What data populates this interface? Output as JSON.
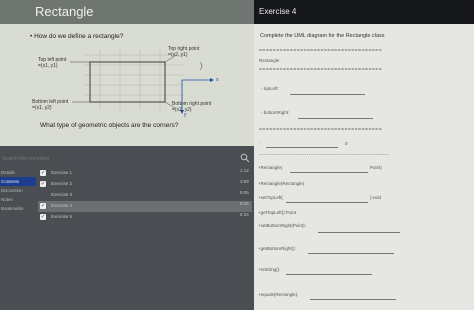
{
  "slide": {
    "title": "Rectangle",
    "bullet": "• How do we define a rectangle?",
    "labels": {
      "top_right": [
        "Top right point",
        "=(x2, y1)"
      ],
      "top_left": [
        "Top left point",
        "=(x1, y1)"
      ],
      "bottom_left": [
        "Bottom left point",
        "=(x1, y2)"
      ],
      "bottom_right": [
        "Bottom right point",
        "=(x2, y2)"
      ]
    },
    "axis_x": "x",
    "axis_y": "y",
    "question": "What type of geometric objects are the corners?"
  },
  "exercise": {
    "title": "Exercise 4",
    "instruction": "Complete the UML diagram for the Rectangle class",
    "class_name": "Rectangle",
    "fields": [
      "- topLeft:",
      "- bottomRight:"
    ],
    "field_zero": "0",
    "methods": [
      {
        "text": "+Rectangle(",
        "suffix": "Point)"
      },
      {
        "text": "+Rectangle(Rectangle)"
      },
      {
        "text": "+setTopLeft(",
        "suffix": "):void"
      },
      {
        "text": "+getTopLeft():Point"
      },
      {
        "text": "+setBottomRight(Point):"
      },
      {
        "text": "+getBottomRight():"
      },
      {
        "text": "+toString():"
      },
      {
        "text": "+equals(Rectangle):"
      }
    ]
  },
  "player": {
    "search_placeholder": "Search this recording",
    "nav": [
      "Details",
      "Contents",
      "Discussion",
      "Notes",
      "Bookmarks"
    ],
    "active_nav": 1,
    "rows": [
      {
        "label": "Exercise 1",
        "time": "1:12",
        "checked": true
      },
      {
        "label": "Exercise 2",
        "time": "3:59",
        "checked": true
      },
      {
        "label": "Exercise 3",
        "time": "5:06",
        "checked": false
      },
      {
        "label": "Exercise 4",
        "time": "6:26",
        "checked": true,
        "active": true
      },
      {
        "label": "Exercise 5",
        "time": "6:34",
        "checked": true
      }
    ]
  }
}
